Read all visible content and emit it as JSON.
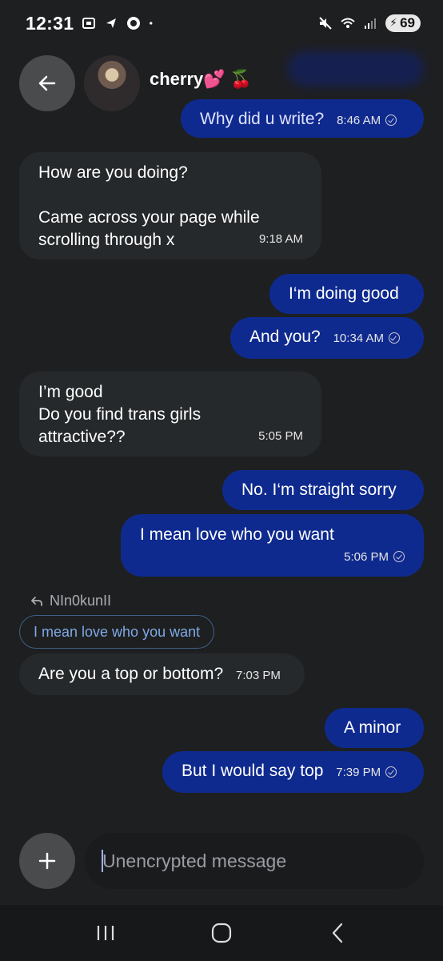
{
  "status": {
    "time": "12:31",
    "battery": "69"
  },
  "header": {
    "contact_name": "cherry💕 🍒"
  },
  "messages": [
    {
      "text": "Why did u write?",
      "time": "8:46 AM"
    },
    {
      "text": "How are you doing?\n\nCame across your page while\nscrolling through x",
      "time": "9:18 AM"
    },
    {
      "text": "I‘m doing good"
    },
    {
      "text": "And you?",
      "time": "10:34 AM"
    },
    {
      "text": "I’m good\nDo you find trans girls\nattractive??",
      "time": "5:05 PM"
    },
    {
      "text": "No. I‘m straight sorry"
    },
    {
      "text": "I mean love who you want",
      "time": "5:06 PM"
    },
    {
      "text": "Are you a top or bottom?",
      "time": "7:03 PM"
    },
    {
      "text": "A minor"
    },
    {
      "text": "But I would say top",
      "time": "7:39 PM"
    }
  ],
  "reply": {
    "author": "NIn0kunII",
    "quoted_text": "I mean love who you want"
  },
  "composer": {
    "placeholder": "Unencrypted message"
  },
  "colors": {
    "background": "#1e1f21",
    "outgoing_bubble": "#0f2a8f",
    "incoming_bubble": "#26292b"
  }
}
